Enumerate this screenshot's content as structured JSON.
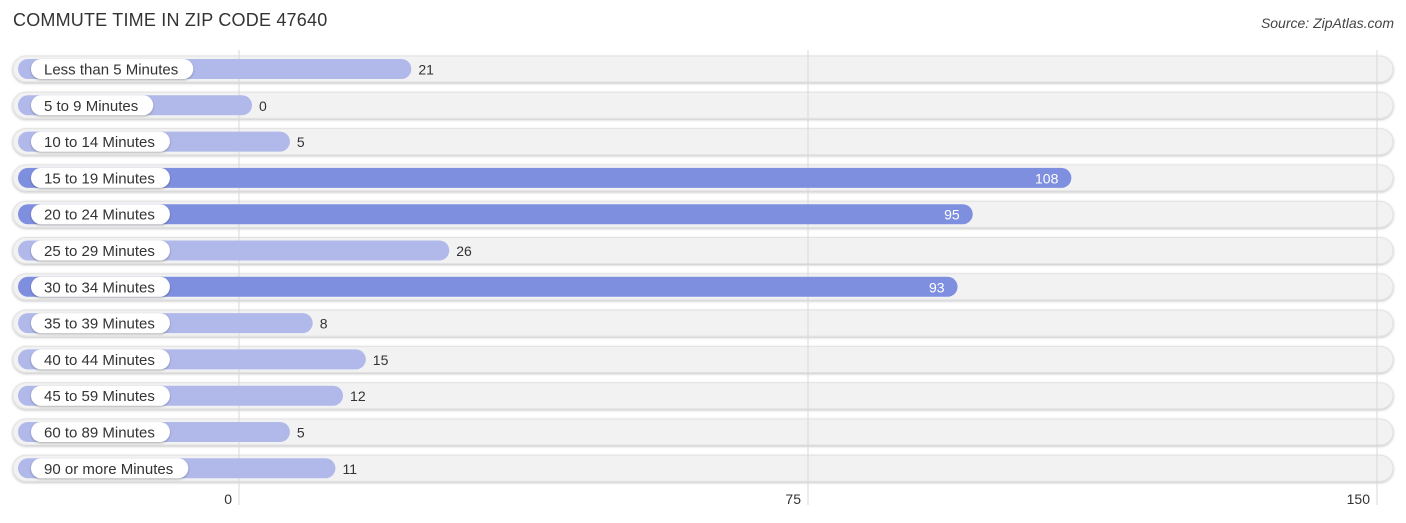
{
  "header": {
    "title": "COMMUTE TIME IN ZIP CODE 47640",
    "source": "Source: ZipAtlas.com"
  },
  "colors": {
    "bar_light": "#b0b9ea",
    "bar_dark": "#7f8fdf",
    "track": "#f2f2f2",
    "grid": "#d8d8d8"
  },
  "chart_data": {
    "type": "bar",
    "orientation": "horizontal",
    "title": "COMMUTE TIME IN ZIP CODE 47640",
    "xlabel": "",
    "ylabel": "",
    "categories": [
      "Less than 5 Minutes",
      "5 to 9 Minutes",
      "10 to 14 Minutes",
      "15 to 19 Minutes",
      "20 to 24 Minutes",
      "25 to 29 Minutes",
      "30 to 34 Minutes",
      "35 to 39 Minutes",
      "40 to 44 Minutes",
      "45 to 59 Minutes",
      "60 to 89 Minutes",
      "90 or more Minutes"
    ],
    "values": [
      21,
      0,
      5,
      108,
      95,
      26,
      93,
      8,
      15,
      12,
      5,
      11
    ],
    "xlim": [
      0,
      150
    ],
    "xticks": [
      0,
      75,
      150
    ],
    "grid": true,
    "value_labels_inside_threshold": 50
  }
}
